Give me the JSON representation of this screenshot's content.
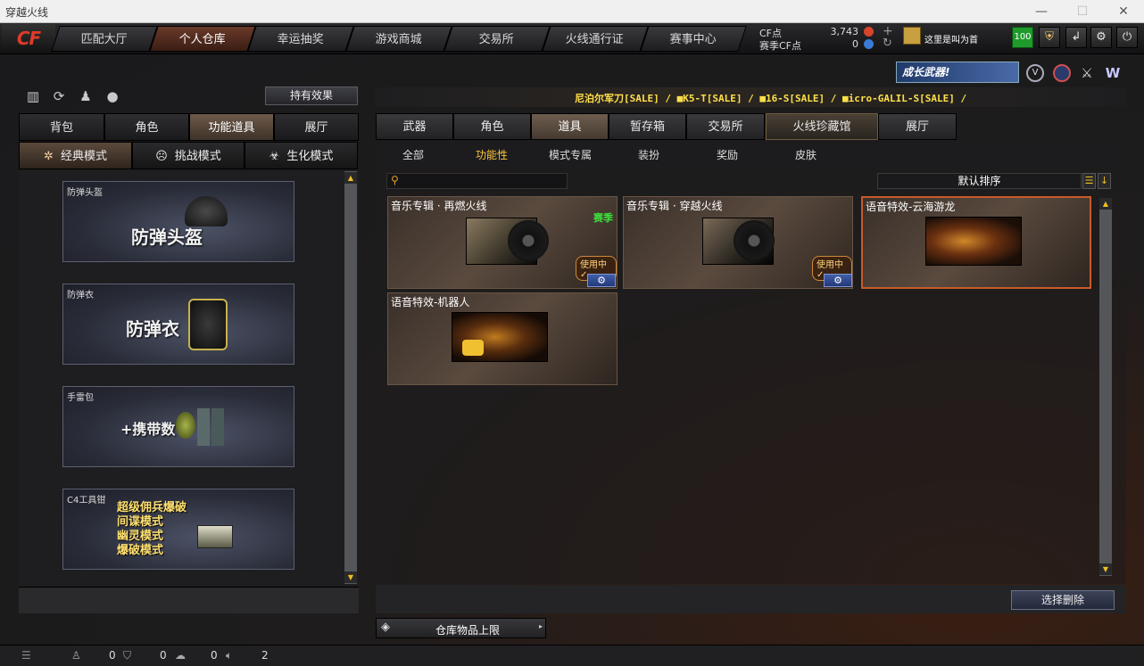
{
  "window": {
    "title": "穿越火线"
  },
  "nav": {
    "tabs": [
      {
        "label": "匹配大厅"
      },
      {
        "label": "个人仓库",
        "active": true
      },
      {
        "label": "幸运抽奖"
      },
      {
        "label": "游戏商城"
      },
      {
        "label": "交易所"
      },
      {
        "label": "火线通行证"
      },
      {
        "label": "赛事中心"
      }
    ],
    "cf_label": "CF点",
    "cf_value": "3,743",
    "season_cf_label": "赛季CF点",
    "season_cf_value": "0",
    "plus_symbol": "+",
    "refresh_symbol": "↻",
    "name_badge": "这里是叫为首",
    "level": "100",
    "icons": [
      "shield-icon",
      "back-arrow-icon",
      "gear-icon",
      "power-icon"
    ]
  },
  "promo": {
    "banner_text": "成长武器!",
    "icons": [
      "badge-v-icon",
      "globe-icon",
      "crossed-swords-icon",
      "w-logo-icon"
    ]
  },
  "left": {
    "effects_button": "持有效果",
    "tabs": [
      {
        "label": "背包"
      },
      {
        "label": "角色"
      },
      {
        "label": "功能道具",
        "active": true
      },
      {
        "label": "展厅"
      }
    ],
    "modes": [
      {
        "label": "经典模式",
        "icon": "star-icon",
        "active": true
      },
      {
        "label": "挑战模式",
        "icon": "skull-icon"
      },
      {
        "label": "生化模式",
        "icon": "biohazard-icon"
      }
    ],
    "cards": [
      {
        "caption": "防弹头盔",
        "text": "防弹头盔"
      },
      {
        "caption": "防弹衣",
        "text": "防弹衣"
      },
      {
        "caption": "手雷包",
        "text": "+携带数"
      },
      {
        "caption": "C4工具钳",
        "lines": [
          "超级佣兵爆破",
          "间谍模式",
          "幽灵模式",
          "爆破模式"
        ]
      }
    ]
  },
  "right": {
    "ticker": "尼泊尔军刀[SALE] / ■K5-T[SALE] / ■16-S[SALE] / ■icro-GALIL-S[SALE] /",
    "tabs": [
      {
        "label": "武器"
      },
      {
        "label": "角色"
      },
      {
        "label": "道具",
        "active": true
      },
      {
        "label": "暂存箱"
      },
      {
        "label": "交易所"
      },
      {
        "label": "火线珍藏馆"
      },
      {
        "label": "展厅"
      }
    ],
    "subtabs": [
      {
        "label": "全部"
      },
      {
        "label": "功能性",
        "active": true
      },
      {
        "label": "模式专属"
      },
      {
        "label": "装扮"
      },
      {
        "label": "奖励"
      },
      {
        "label": "皮肤"
      }
    ],
    "search_placeholder": "",
    "sort_label": "默认排序",
    "items": [
      {
        "name": "音乐专辑 · 再燃火线",
        "tag": "赛季",
        "status": "使用中✓",
        "gear": "⚙"
      },
      {
        "name": "音乐专辑 · 穿越火线",
        "status": "使用中✓",
        "gear": "⚙"
      },
      {
        "name": "语音特效-云海游龙"
      },
      {
        "name": "语音特效-机器人"
      }
    ],
    "delete_button": "选择删除",
    "capacity_label": "仓库物品上限"
  },
  "statusbar": {
    "count1": "0",
    "count2": "0",
    "count3": "0",
    "count4": "2"
  }
}
